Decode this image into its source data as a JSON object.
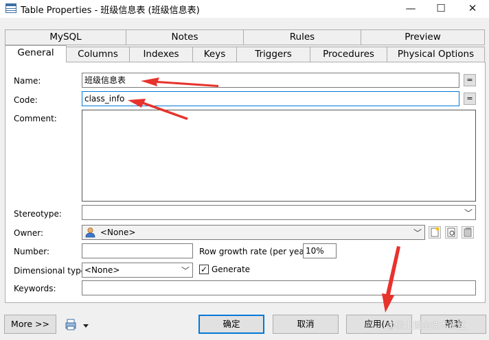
{
  "window": {
    "title": "Table Properties - 班级信息表 (班级信息表)",
    "minimize_glyph": "—",
    "maximize_glyph": "☐",
    "close_glyph": "✕"
  },
  "tabs_row1": [
    "MySQL",
    "Notes",
    "Rules",
    "Preview"
  ],
  "tabs_row2": [
    "General",
    "Columns",
    "Indexes",
    "Keys",
    "Triggers",
    "Procedures",
    "Physical Options"
  ],
  "form": {
    "name_label": "Name:",
    "name_value": "班级信息表",
    "code_label": "Code:",
    "code_value": "class_info",
    "comment_label": "Comment:",
    "comment_value": "",
    "stereotype_label": "Stereotype:",
    "stereotype_value": "",
    "owner_label": "Owner:",
    "owner_value": "<None>",
    "number_label": "Number:",
    "number_value": "",
    "row_growth_label": "Row growth rate (per year):",
    "row_growth_value": "10%",
    "dimensional_label": "Dimensional type:",
    "dimensional_value": "<None>",
    "generate_label": "Generate",
    "generate_checked": true,
    "keywords_label": "Keywords:",
    "keywords_value": "",
    "eq_glyph": "="
  },
  "buttons": {
    "more": "More >>",
    "ok": "确定",
    "cancel": "取消",
    "apply": "应用(A)",
    "help": "帮助"
  },
  "watermark": "@稀土掘金技术社区",
  "colors": {
    "annotation_arrow": "#e8322c",
    "focus_border": "#0078d7"
  }
}
